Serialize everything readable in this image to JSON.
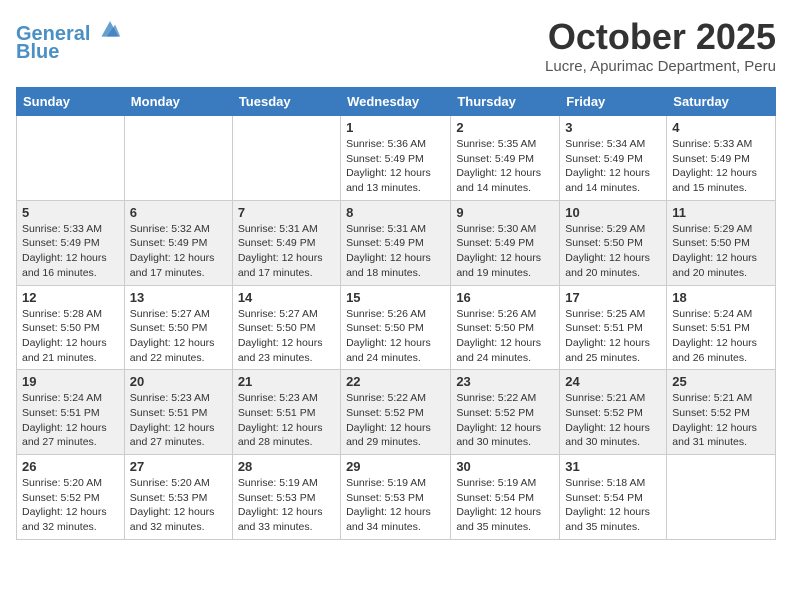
{
  "header": {
    "logo_line1": "General",
    "logo_line2": "Blue",
    "month_title": "October 2025",
    "location": "Lucre, Apurimac Department, Peru"
  },
  "days_of_week": [
    "Sunday",
    "Monday",
    "Tuesday",
    "Wednesday",
    "Thursday",
    "Friday",
    "Saturday"
  ],
  "weeks": [
    [
      {
        "day": "",
        "info": ""
      },
      {
        "day": "",
        "info": ""
      },
      {
        "day": "",
        "info": ""
      },
      {
        "day": "1",
        "info": "Sunrise: 5:36 AM\nSunset: 5:49 PM\nDaylight: 12 hours\nand 13 minutes."
      },
      {
        "day": "2",
        "info": "Sunrise: 5:35 AM\nSunset: 5:49 PM\nDaylight: 12 hours\nand 14 minutes."
      },
      {
        "day": "3",
        "info": "Sunrise: 5:34 AM\nSunset: 5:49 PM\nDaylight: 12 hours\nand 14 minutes."
      },
      {
        "day": "4",
        "info": "Sunrise: 5:33 AM\nSunset: 5:49 PM\nDaylight: 12 hours\nand 15 minutes."
      }
    ],
    [
      {
        "day": "5",
        "info": "Sunrise: 5:33 AM\nSunset: 5:49 PM\nDaylight: 12 hours\nand 16 minutes."
      },
      {
        "day": "6",
        "info": "Sunrise: 5:32 AM\nSunset: 5:49 PM\nDaylight: 12 hours\nand 17 minutes."
      },
      {
        "day": "7",
        "info": "Sunrise: 5:31 AM\nSunset: 5:49 PM\nDaylight: 12 hours\nand 17 minutes."
      },
      {
        "day": "8",
        "info": "Sunrise: 5:31 AM\nSunset: 5:49 PM\nDaylight: 12 hours\nand 18 minutes."
      },
      {
        "day": "9",
        "info": "Sunrise: 5:30 AM\nSunset: 5:49 PM\nDaylight: 12 hours\nand 19 minutes."
      },
      {
        "day": "10",
        "info": "Sunrise: 5:29 AM\nSunset: 5:50 PM\nDaylight: 12 hours\nand 20 minutes."
      },
      {
        "day": "11",
        "info": "Sunrise: 5:29 AM\nSunset: 5:50 PM\nDaylight: 12 hours\nand 20 minutes."
      }
    ],
    [
      {
        "day": "12",
        "info": "Sunrise: 5:28 AM\nSunset: 5:50 PM\nDaylight: 12 hours\nand 21 minutes."
      },
      {
        "day": "13",
        "info": "Sunrise: 5:27 AM\nSunset: 5:50 PM\nDaylight: 12 hours\nand 22 minutes."
      },
      {
        "day": "14",
        "info": "Sunrise: 5:27 AM\nSunset: 5:50 PM\nDaylight: 12 hours\nand 23 minutes."
      },
      {
        "day": "15",
        "info": "Sunrise: 5:26 AM\nSunset: 5:50 PM\nDaylight: 12 hours\nand 24 minutes."
      },
      {
        "day": "16",
        "info": "Sunrise: 5:26 AM\nSunset: 5:50 PM\nDaylight: 12 hours\nand 24 minutes."
      },
      {
        "day": "17",
        "info": "Sunrise: 5:25 AM\nSunset: 5:51 PM\nDaylight: 12 hours\nand 25 minutes."
      },
      {
        "day": "18",
        "info": "Sunrise: 5:24 AM\nSunset: 5:51 PM\nDaylight: 12 hours\nand 26 minutes."
      }
    ],
    [
      {
        "day": "19",
        "info": "Sunrise: 5:24 AM\nSunset: 5:51 PM\nDaylight: 12 hours\nand 27 minutes."
      },
      {
        "day": "20",
        "info": "Sunrise: 5:23 AM\nSunset: 5:51 PM\nDaylight: 12 hours\nand 27 minutes."
      },
      {
        "day": "21",
        "info": "Sunrise: 5:23 AM\nSunset: 5:51 PM\nDaylight: 12 hours\nand 28 minutes."
      },
      {
        "day": "22",
        "info": "Sunrise: 5:22 AM\nSunset: 5:52 PM\nDaylight: 12 hours\nand 29 minutes."
      },
      {
        "day": "23",
        "info": "Sunrise: 5:22 AM\nSunset: 5:52 PM\nDaylight: 12 hours\nand 30 minutes."
      },
      {
        "day": "24",
        "info": "Sunrise: 5:21 AM\nSunset: 5:52 PM\nDaylight: 12 hours\nand 30 minutes."
      },
      {
        "day": "25",
        "info": "Sunrise: 5:21 AM\nSunset: 5:52 PM\nDaylight: 12 hours\nand 31 minutes."
      }
    ],
    [
      {
        "day": "26",
        "info": "Sunrise: 5:20 AM\nSunset: 5:52 PM\nDaylight: 12 hours\nand 32 minutes."
      },
      {
        "day": "27",
        "info": "Sunrise: 5:20 AM\nSunset: 5:53 PM\nDaylight: 12 hours\nand 32 minutes."
      },
      {
        "day": "28",
        "info": "Sunrise: 5:19 AM\nSunset: 5:53 PM\nDaylight: 12 hours\nand 33 minutes."
      },
      {
        "day": "29",
        "info": "Sunrise: 5:19 AM\nSunset: 5:53 PM\nDaylight: 12 hours\nand 34 minutes."
      },
      {
        "day": "30",
        "info": "Sunrise: 5:19 AM\nSunset: 5:54 PM\nDaylight: 12 hours\nand 35 minutes."
      },
      {
        "day": "31",
        "info": "Sunrise: 5:18 AM\nSunset: 5:54 PM\nDaylight: 12 hours\nand 35 minutes."
      },
      {
        "day": "",
        "info": ""
      }
    ]
  ]
}
